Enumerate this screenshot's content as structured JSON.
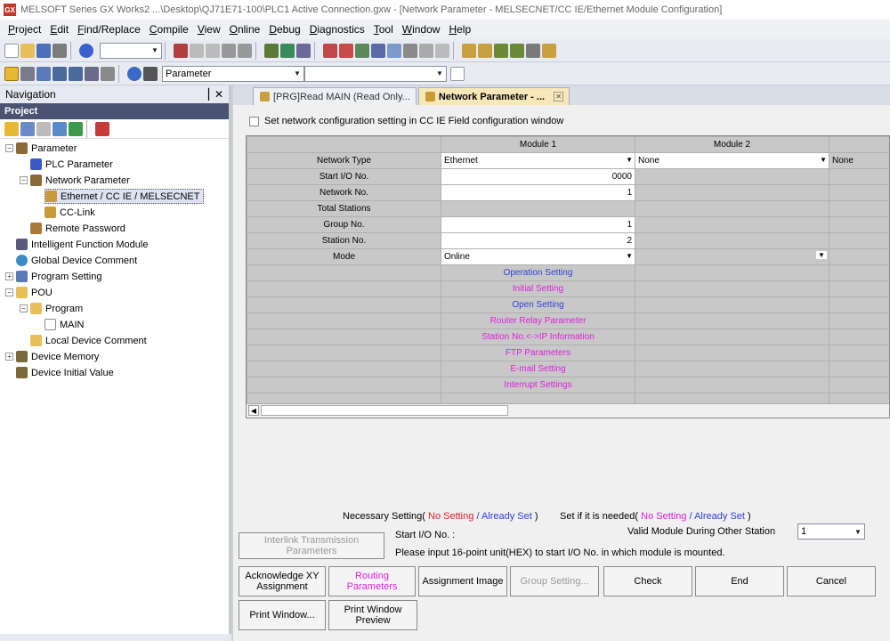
{
  "titlebar": {
    "text": "MELSOFT Series GX Works2 ...\\Desktop\\QJ71E71-100\\PLC1 Active Connection.gxw - [Network Parameter - MELSECNET/CC IE/Ethernet Module Configuration]",
    "icon_label": "GX"
  },
  "menu": [
    {
      "label": "Project",
      "u": "P"
    },
    {
      "label": "Edit",
      "u": "E"
    },
    {
      "label": "Find/Replace",
      "u": "F"
    },
    {
      "label": "Compile",
      "u": "C"
    },
    {
      "label": "View",
      "u": "V"
    },
    {
      "label": "Online",
      "u": "O"
    },
    {
      "label": "Debug",
      "u": "D"
    },
    {
      "label": "Diagnostics",
      "u": "D"
    },
    {
      "label": "Tool",
      "u": "T"
    },
    {
      "label": "Window",
      "u": "W"
    },
    {
      "label": "Help",
      "u": "H"
    }
  ],
  "toolbar2": {
    "combo_value": "Parameter"
  },
  "nav": {
    "title": "Navigation",
    "pin": "▕",
    "close": "✕",
    "project_label": "Project",
    "tree": {
      "parameter": "Parameter",
      "plc_parameter": "PLC Parameter",
      "network_parameter": "Network Parameter",
      "ethernet": "Ethernet / CC IE / MELSECNET",
      "cclink": "CC-Link",
      "remote_password": "Remote Password",
      "intelligent": "Intelligent Function Module",
      "global_comment": "Global Device Comment",
      "program_setting": "Program Setting",
      "pou": "POU",
      "program": "Program",
      "main": "MAIN",
      "local_comment": "Local Device Comment",
      "device_memory": "Device Memory",
      "device_initial": "Device Initial Value"
    }
  },
  "tabs": [
    {
      "label": "[PRG]Read MAIN (Read Only..."
    },
    {
      "label": "Network Parameter - ..."
    }
  ],
  "checkbox_label": "Set network configuration setting in CC IE Field configuration window",
  "grid": {
    "headers": [
      "",
      "Module 1",
      "Module 2",
      ""
    ],
    "network_type": {
      "label": "Network Type",
      "m1": "Ethernet",
      "m2": "None",
      "m3": "None"
    },
    "start_io": {
      "label": "Start I/O No.",
      "m1": "0000"
    },
    "network_no": {
      "label": "Network No.",
      "m1": "1"
    },
    "total_stations": {
      "label": "Total Stations"
    },
    "group_no": {
      "label": "Group No.",
      "m1": "1"
    },
    "station_no": {
      "label": "Station No.",
      "m1": "2"
    },
    "mode": {
      "label": "Mode",
      "m1": "Online"
    },
    "settings": [
      {
        "label": "Operation Setting",
        "color": "#2f3fdc"
      },
      {
        "label": "Initial Setting",
        "color": "#e020e0"
      },
      {
        "label": "Open Setting",
        "color": "#2f3fdc"
      },
      {
        "label": "Router Relay Parameter",
        "color": "#e020e0"
      },
      {
        "label": "Station No.<->IP Information",
        "color": "#e020e0"
      },
      {
        "label": "FTP Parameters",
        "color": "#e020e0"
      },
      {
        "label": "E-mail Setting",
        "color": "#e020e0"
      },
      {
        "label": "Interrupt Settings",
        "color": "#e020e0"
      }
    ]
  },
  "legend": {
    "necessary": "Necessary Setting(",
    "no_setting": "No Setting",
    "slash": "/",
    "already_set": "Already Set",
    "close": ")",
    "if_needed": "Set if it is needed(",
    "no_setting2": "No Setting",
    "already_set2": "Already Set"
  },
  "info": {
    "start_io": "Start I/O No. :",
    "hint": "Please input 16-point unit(HEX) to start I/O No. in which module is mounted.",
    "valid_label": "Valid Module During Other Station",
    "valid_value": "1"
  },
  "buttons": {
    "interlink": "Interlink Transmission Parameters",
    "ack_xy": "Acknowledge XY Assignment",
    "routing": "Routing Parameters",
    "assign_image": "Assignment Image",
    "group_setting": "Group Setting...",
    "check": "Check",
    "end": "End",
    "cancel": "Cancel",
    "print_window": "Print Window...",
    "print_preview": "Print Window Preview"
  }
}
